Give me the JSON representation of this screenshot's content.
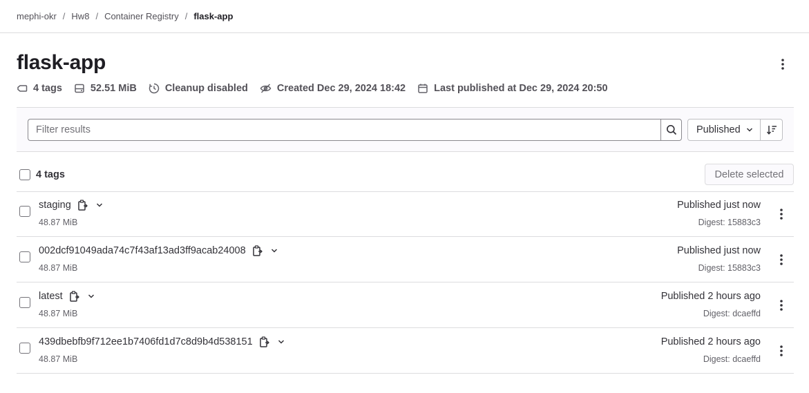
{
  "breadcrumb": {
    "items": [
      "mephi-okr",
      "Hw8",
      "Container Registry",
      "flask-app"
    ],
    "separator": "/"
  },
  "page": {
    "title": "flask-app"
  },
  "meta": {
    "tags": "4 tags",
    "size": "52.51 MiB",
    "cleanup": "Cleanup disabled",
    "created": "Created Dec 29, 2024 18:42",
    "last_published": "Last published at Dec 29, 2024 20:50"
  },
  "filter": {
    "placeholder": "Filter results",
    "sort_label": "Published"
  },
  "list": {
    "count_label": "4 tags",
    "delete_label": "Delete selected"
  },
  "tags": [
    {
      "name": "staging",
      "size": "48.87 MiB",
      "published": "Published just now",
      "digest": "Digest: 15883c3"
    },
    {
      "name": "002dcf91049ada74c7f43af13ad3ff9acab24008",
      "size": "48.87 MiB",
      "published": "Published just now",
      "digest": "Digest: 15883c3"
    },
    {
      "name": "latest",
      "size": "48.87 MiB",
      "published": "Published 2 hours ago",
      "digest": "Digest: dcaeffd"
    },
    {
      "name": "439dbebfb9f712ee1b7406fd1d7c8d9b4d538151",
      "size": "48.87 MiB",
      "published": "Published 2 hours ago",
      "digest": "Digest: dcaeffd"
    }
  ],
  "icons": {
    "tag": "tag-icon",
    "storage": "storage-icon",
    "cleanup": "clock-icon",
    "created": "eye-slash-icon",
    "published": "calendar-icon",
    "search": "search-icon",
    "sort": "sort-icon",
    "copy": "copy-icon",
    "expand": "chevron-down-icon",
    "more": "kebab-icon"
  }
}
